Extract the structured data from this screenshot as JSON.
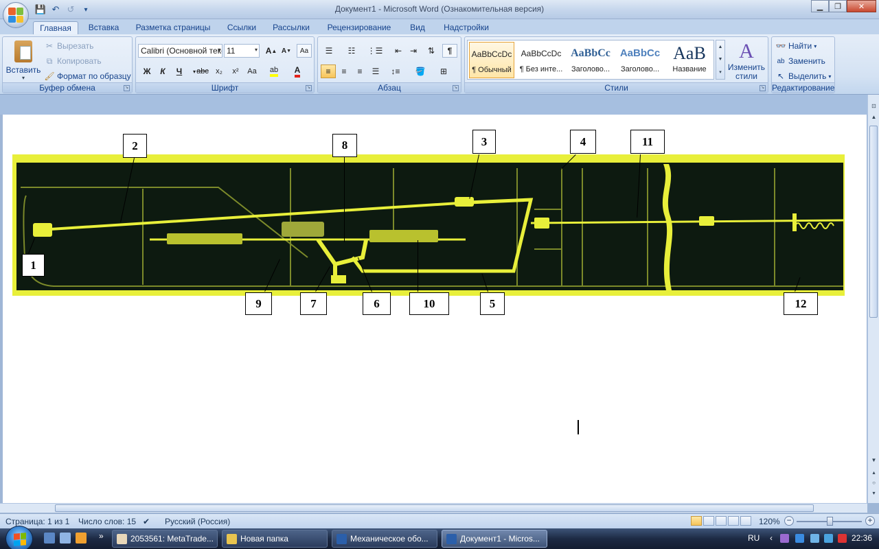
{
  "window": {
    "title": "Документ1 - Microsoft Word (Ознакомительная версия)",
    "minimize": "▁",
    "maximize": "❐",
    "close": "✕"
  },
  "qat": {
    "save": "💾",
    "undo": "↶",
    "redo": "↺",
    "customize": "▾"
  },
  "tabs": [
    "Главная",
    "Вставка",
    "Разметка страницы",
    "Ссылки",
    "Рассылки",
    "Рецензирование",
    "Вид",
    "Надстройки"
  ],
  "help": "?",
  "clipboard": {
    "group": "Буфер обмена",
    "paste": "Вставить",
    "cut": "Вырезать",
    "copy": "Копировать",
    "format_painter": "Формат по образцу"
  },
  "font": {
    "group": "Шрифт",
    "family": "Calibri (Основной текст)",
    "size": "11",
    "grow": "A",
    "shrink": "A",
    "bold": "Ж",
    "italic": "К",
    "underline": "Ч",
    "strike": "abc",
    "subscript": "x₂",
    "superscript": "x²",
    "case": "Aa",
    "color_letter": "A"
  },
  "paragraph": {
    "group": "Абзац",
    "show_marks": "¶"
  },
  "styles": {
    "group": "Стили",
    "items": [
      {
        "sample": "AaBbCcDc",
        "name": "¶ Обычный"
      },
      {
        "sample": "AaBbCcDc",
        "name": "¶ Без инте..."
      },
      {
        "sample": "AaBbCc",
        "name": "Заголово..."
      },
      {
        "sample": "AaBbCc",
        "name": "Заголово..."
      },
      {
        "sample": "AaB",
        "name": "Название"
      }
    ],
    "change": "Изменить стили"
  },
  "editing": {
    "group": "Редактирование",
    "find": "Найти",
    "replace": "Заменить",
    "select": "Выделить"
  },
  "figure": {
    "callouts": [
      "1",
      "2",
      "3",
      "4",
      "5",
      "6",
      "7",
      "8",
      "9",
      "10",
      "11",
      "12"
    ]
  },
  "status": {
    "page": "Страница: 1 из 1",
    "words": "Число слов: 15",
    "language": "Русский (Россия)",
    "zoom": "120%",
    "zoom_minus": "−",
    "zoom_plus": "+"
  },
  "taskbar": {
    "items": [
      {
        "label": "2053561: MetaTrade...",
        "color": "#e8d7b9"
      },
      {
        "label": "Новая папка",
        "color": "#e8c44f"
      },
      {
        "label": "Механическое обо...",
        "color": "#2b5faa"
      },
      {
        "label": "Документ1 - Micros...",
        "color": "#2b5faa"
      }
    ],
    "lang": "RU",
    "time": "22:36"
  },
  "colors": {
    "figure_bg": "#0d1a10",
    "figure_yellow": "#e8ef3a",
    "ribbon": "#dbe7f6"
  }
}
